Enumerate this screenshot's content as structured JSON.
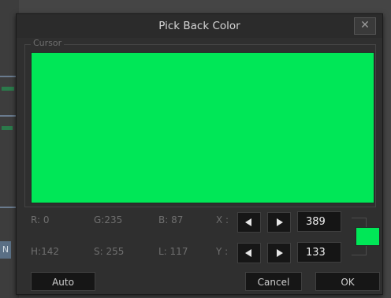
{
  "dialog": {
    "title": "Pick Back Color",
    "close_symbol": "✕",
    "group_label": "Cursor",
    "current_color": "#00E757"
  },
  "values": {
    "r": "R: 0",
    "g": "G:235",
    "b": "B: 87",
    "h": "H:142",
    "s": "S: 255",
    "l": "L: 117"
  },
  "coords": {
    "x_label": "X :",
    "y_label": "Y :",
    "x_value": "389",
    "y_value": "133"
  },
  "buttons": {
    "auto": "Auto",
    "cancel": "Cancel",
    "ok": "OK"
  },
  "backdrop": {
    "n_label": "N"
  },
  "icons": {
    "close": "close-icon",
    "left": "arrow-left-icon",
    "right": "arrow-right-icon"
  }
}
